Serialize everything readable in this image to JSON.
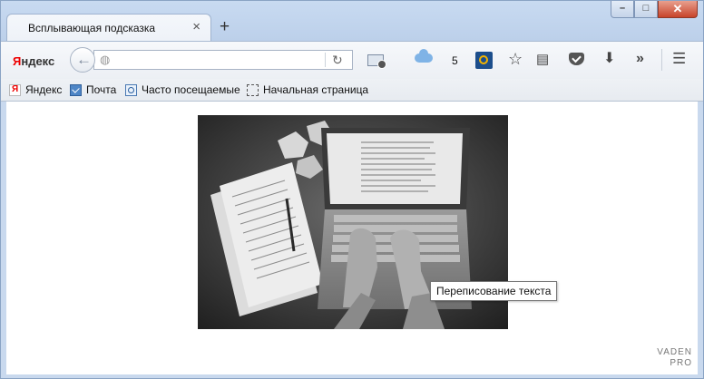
{
  "tab": {
    "title": "Всплывающая подсказка",
    "close_glyph": "×",
    "new_tab_glyph": "+"
  },
  "window_controls": {
    "minimize": "–",
    "maximize": "□",
    "close": "✕"
  },
  "toolbar": {
    "yandex_logo_first": "Я",
    "yandex_logo_rest": "ндекс",
    "back_glyph": "←",
    "url_value": "",
    "url_placeholder": "",
    "weather_temp": "5",
    "icons": [
      "back-icon",
      "globe-icon",
      "reload-icon",
      "mail-icon",
      "cloud-icon",
      "app-icon",
      "star-icon",
      "reader-list-icon",
      "pocket-icon",
      "download-icon",
      "overflow-icon",
      "menu-icon"
    ]
  },
  "bookmarks": [
    {
      "label": "Яндекс",
      "icon": "yandex-icon"
    },
    {
      "label": "Почта",
      "icon": "mail-icon"
    },
    {
      "label": "Часто посещаемые",
      "icon": "frequent-icon"
    },
    {
      "label": "Начальная страница",
      "icon": "home-page-icon"
    }
  ],
  "content": {
    "tooltip": "Переписование текста"
  },
  "watermark": {
    "line1": "VADEN",
    "line2": "PRO"
  },
  "colors": {
    "frame": "#c9d9ee",
    "tooltip_border": "#767676",
    "yandex_red": "#ee0000"
  }
}
